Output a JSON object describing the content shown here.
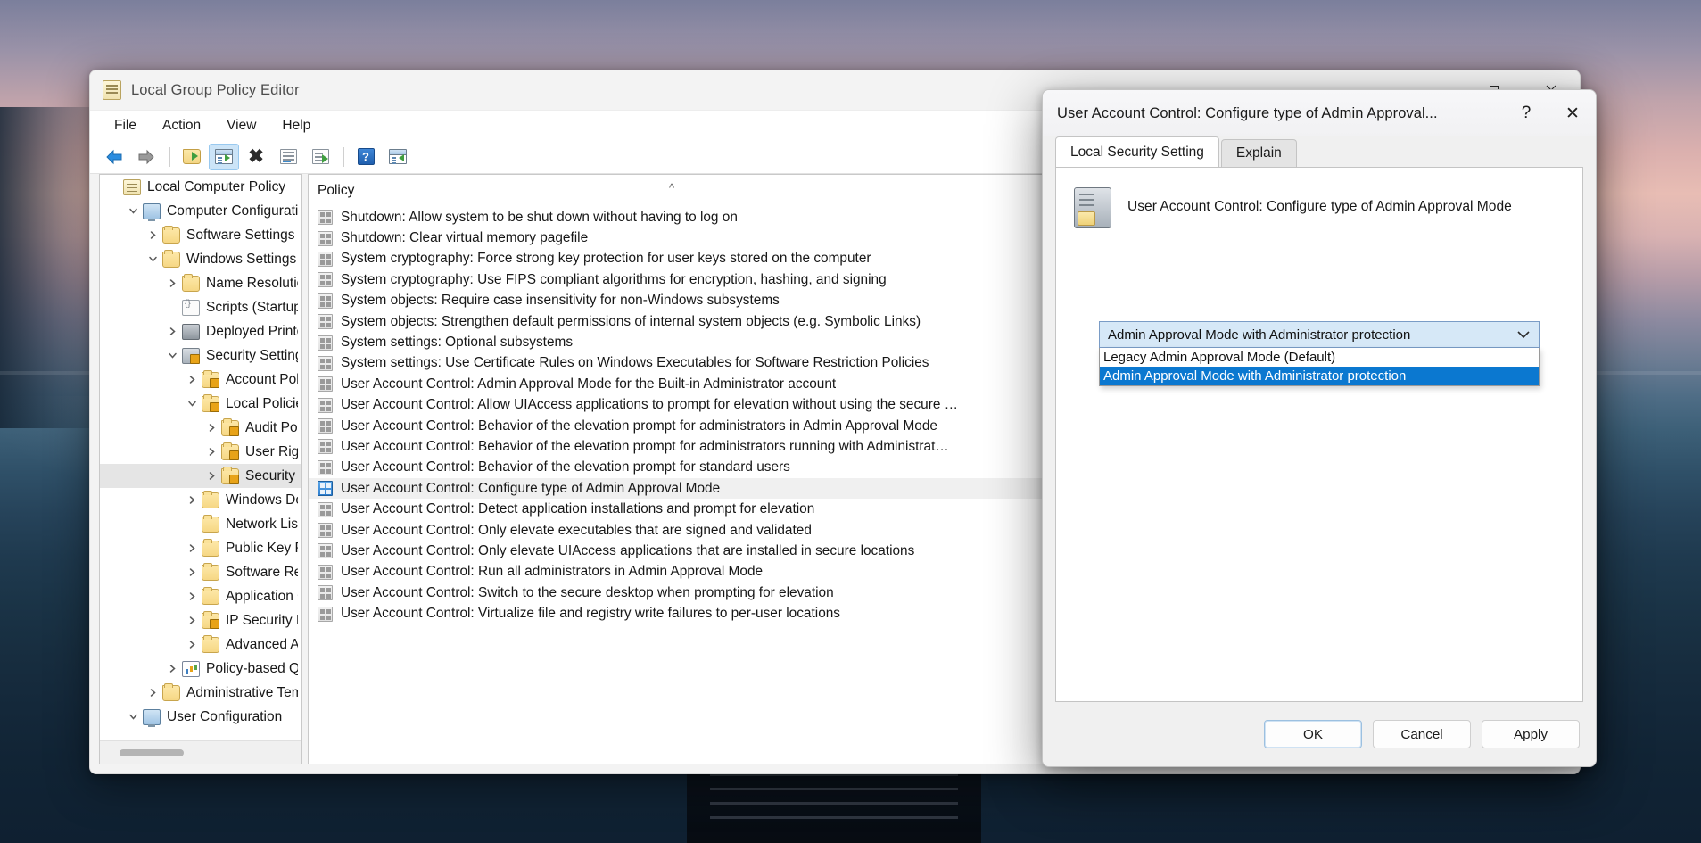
{
  "window": {
    "title": "Local Group Policy Editor",
    "title_icon": "policy-scroll-icon",
    "caption": {
      "minimize": "minimize-icon",
      "maximize": "maximize-icon",
      "close": "close-icon"
    },
    "menus": [
      "File",
      "Action",
      "View",
      "Help"
    ],
    "toolbar": [
      {
        "name": "back-button",
        "icon": "back-arrow-icon"
      },
      {
        "name": "forward-button",
        "icon": "forward-arrow-icon"
      },
      {
        "name": "up-one-level-button",
        "icon": "folder-up-icon"
      },
      {
        "name": "show-hide-console-tree-button",
        "icon": "console-tree-icon",
        "active": true
      },
      {
        "name": "delete-button",
        "icon": "delete-x-icon"
      },
      {
        "name": "properties-button",
        "icon": "properties-icon"
      },
      {
        "name": "export-list-button",
        "icon": "export-list-icon"
      },
      {
        "name": "help-button",
        "icon": "help-question-icon"
      },
      {
        "name": "show-action-pane-button",
        "icon": "action-pane-icon"
      }
    ]
  },
  "tree": {
    "items": [
      {
        "label": "Local Computer Policy",
        "indent": 0,
        "twisty": "none",
        "icon": "policy-scroll-icon",
        "selected": false
      },
      {
        "label": "Computer Configuration",
        "indent": 1,
        "twisty": "expanded",
        "icon": "computer-icon",
        "selected": false
      },
      {
        "label": "Software Settings",
        "indent": 2,
        "twisty": "collapsed",
        "icon": "folder-icon",
        "selected": false
      },
      {
        "label": "Windows Settings",
        "indent": 2,
        "twisty": "expanded",
        "icon": "folder-icon",
        "selected": false
      },
      {
        "label": "Name Resolution Policy",
        "indent": 3,
        "twisty": "collapsed",
        "icon": "folder-icon",
        "selected": false
      },
      {
        "label": "Scripts (Startup/Shutdown)",
        "indent": 3,
        "twisty": "none",
        "icon": "script-icon",
        "selected": false
      },
      {
        "label": "Deployed Printers",
        "indent": 3,
        "twisty": "collapsed",
        "icon": "printer-icon",
        "selected": false
      },
      {
        "label": "Security Settings",
        "indent": 3,
        "twisty": "expanded",
        "icon": "security-server-icon",
        "selected": false
      },
      {
        "label": "Account Policies",
        "indent": 4,
        "twisty": "collapsed",
        "icon": "folder-lock-icon",
        "selected": false
      },
      {
        "label": "Local Policies",
        "indent": 4,
        "twisty": "expanded",
        "icon": "folder-lock-icon",
        "selected": false
      },
      {
        "label": "Audit Policy",
        "indent": 5,
        "twisty": "collapsed",
        "icon": "folder-lock-icon",
        "selected": false
      },
      {
        "label": "User Rights Assignment",
        "indent": 5,
        "twisty": "collapsed",
        "icon": "folder-lock-icon",
        "selected": false
      },
      {
        "label": "Security Options",
        "indent": 5,
        "twisty": "collapsed",
        "icon": "folder-lock-icon",
        "selected": true
      },
      {
        "label": "Windows Defender Firewall with Advanced Security",
        "indent": 4,
        "twisty": "collapsed",
        "icon": "folder-icon",
        "selected": false
      },
      {
        "label": "Network List Manager Policies",
        "indent": 4,
        "twisty": "none",
        "icon": "folder-icon",
        "selected": false
      },
      {
        "label": "Public Key Policies",
        "indent": 4,
        "twisty": "collapsed",
        "icon": "folder-icon",
        "selected": false
      },
      {
        "label": "Software Restriction Policies",
        "indent": 4,
        "twisty": "collapsed",
        "icon": "folder-icon",
        "selected": false
      },
      {
        "label": "Application Control Policies",
        "indent": 4,
        "twisty": "collapsed",
        "icon": "folder-icon",
        "selected": false
      },
      {
        "label": "IP Security Policies on Local Computer",
        "indent": 4,
        "twisty": "collapsed",
        "icon": "ipsec-icon",
        "selected": false
      },
      {
        "label": "Advanced Audit Policy Configuration",
        "indent": 4,
        "twisty": "collapsed",
        "icon": "folder-icon",
        "selected": false
      },
      {
        "label": "Policy-based QoS",
        "indent": 3,
        "twisty": "collapsed",
        "icon": "chart-icon",
        "selected": false
      },
      {
        "label": "Administrative Templates",
        "indent": 2,
        "twisty": "collapsed",
        "icon": "folder-icon",
        "selected": false
      },
      {
        "label": "User Configuration",
        "indent": 1,
        "twisty": "expanded",
        "icon": "computer-icon",
        "selected": false
      }
    ]
  },
  "list": {
    "column_header": "Policy",
    "sort_indicator": "ascending-caret-icon",
    "rows": [
      {
        "label": "Shutdown: Allow system to be shut down without having to log on",
        "selected": false
      },
      {
        "label": "Shutdown: Clear virtual memory pagefile",
        "selected": false
      },
      {
        "label": "System cryptography: Force strong key protection for user keys stored on the computer",
        "selected": false
      },
      {
        "label": "System cryptography: Use FIPS compliant algorithms for encryption, hashing, and signing",
        "selected": false
      },
      {
        "label": "System objects: Require case insensitivity for non-Windows subsystems",
        "selected": false
      },
      {
        "label": "System objects: Strengthen default permissions of internal system objects (e.g. Symbolic Links)",
        "selected": false
      },
      {
        "label": "System settings: Optional subsystems",
        "selected": false
      },
      {
        "label": "System settings: Use Certificate Rules on Windows Executables for Software Restriction Policies",
        "selected": false
      },
      {
        "label": "User Account Control: Admin Approval Mode for the Built-in Administrator account",
        "selected": false
      },
      {
        "label": "User Account Control: Allow UIAccess applications to prompt for elevation without using the secure …",
        "selected": false
      },
      {
        "label": "User Account Control: Behavior of the elevation prompt for administrators in Admin Approval Mode",
        "selected": false
      },
      {
        "label": "User Account Control: Behavior of the elevation prompt for administrators running with Administrat…",
        "selected": false
      },
      {
        "label": "User Account Control: Behavior of the elevation prompt for standard users",
        "selected": false
      },
      {
        "label": "User Account Control: Configure type of Admin Approval Mode",
        "selected": true
      },
      {
        "label": "User Account Control: Detect application installations and prompt for elevation",
        "selected": false
      },
      {
        "label": "User Account Control: Only elevate executables that are signed and validated",
        "selected": false
      },
      {
        "label": "User Account Control: Only elevate UIAccess applications that are installed in secure locations",
        "selected": false
      },
      {
        "label": "User Account Control: Run all administrators in Admin Approval Mode",
        "selected": false
      },
      {
        "label": "User Account Control: Switch to the secure desktop when prompting for elevation",
        "selected": false
      },
      {
        "label": "User Account Control: Virtualize file and registry write failures to per-user locations",
        "selected": false
      }
    ]
  },
  "dialog": {
    "title": "User Account Control: Configure type of Admin Approval...",
    "help_label": "?",
    "close_label": "✕",
    "tabs": [
      {
        "label": "Local Security Setting",
        "active": true
      },
      {
        "label": "Explain",
        "active": false
      }
    ],
    "policy_name": "User Account Control: Configure type of Admin Approval Mode",
    "policy_icon": "security-policy-icon",
    "combo": {
      "value": "Admin Approval Mode with Administrator protection",
      "chevron": "chevron-down-icon",
      "options": [
        {
          "label": "Legacy Admin Approval Mode (Default)",
          "selected": false
        },
        {
          "label": "Admin Approval Mode with Administrator protection",
          "selected": true
        }
      ]
    },
    "buttons": [
      {
        "label": "OK",
        "name": "ok-button",
        "default": true
      },
      {
        "label": "Cancel",
        "name": "cancel-button",
        "default": false
      },
      {
        "label": "Apply",
        "name": "apply-button",
        "default": false
      }
    ]
  },
  "colors": {
    "selection_blue": "#0b78d0",
    "combo_fill": "#d6e8f7",
    "accent": "#2f7fd0"
  }
}
